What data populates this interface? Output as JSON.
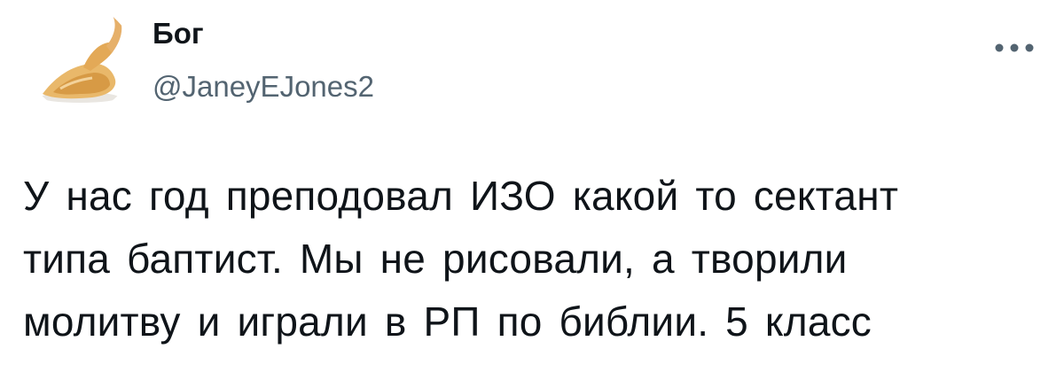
{
  "tweet": {
    "display_name": "Бог",
    "handle": "@JaneyEJones2",
    "avatar_icon": "roast-chicken-avatar",
    "more_icon": "more-horizontal-icon",
    "text": "У нас год преподовал ИЗО какой то сектант\nтипа баптист. Мы не рисовали, а творили\nмолитву и играли в РП по библии. 5 класс"
  },
  "colors": {
    "text_primary": "#0f1419",
    "text_secondary": "#536471",
    "background": "#ffffff"
  }
}
